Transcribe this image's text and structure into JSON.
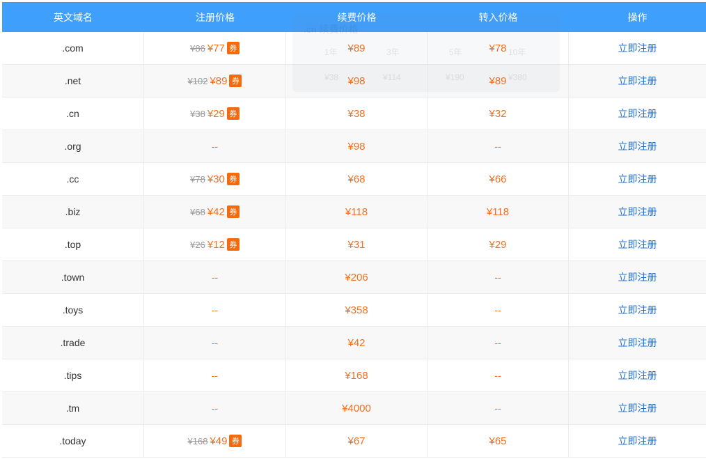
{
  "header": {
    "col_domain": "英文域名",
    "col_register": "注册价格",
    "col_renew": "续费价格",
    "col_transfer": "转入价格",
    "col_action": "操作"
  },
  "ghost_popup": {
    "title": ".cn 续费价格",
    "years": [
      "1年",
      "3年",
      "5年",
      "10年"
    ],
    "prices": [
      "¥38",
      "¥114",
      "¥190",
      "¥380"
    ]
  },
  "coupon_label": "券",
  "action_label": "立即注册",
  "rows": [
    {
      "domain": ".com",
      "orig": "¥86",
      "reg": "¥77",
      "renew": "¥89",
      "transfer": "¥78"
    },
    {
      "domain": ".net",
      "orig": "¥102",
      "reg": "¥89",
      "renew": "¥98",
      "transfer": "¥89"
    },
    {
      "domain": ".cn",
      "orig": "¥38",
      "reg": "¥29",
      "renew": "¥38",
      "transfer": "¥32"
    },
    {
      "domain": ".org",
      "orig": "",
      "reg": "--",
      "renew": "¥98",
      "transfer": "--"
    },
    {
      "domain": ".cc",
      "orig": "¥78",
      "reg": "¥30",
      "renew": "¥68",
      "transfer": "¥66"
    },
    {
      "domain": ".biz",
      "orig": "¥68",
      "reg": "¥42",
      "renew": "¥118",
      "transfer": "¥118"
    },
    {
      "domain": ".top",
      "orig": "¥26",
      "reg": "¥12",
      "renew": "¥31",
      "transfer": "¥29"
    },
    {
      "domain": ".town",
      "orig": "",
      "reg": "--",
      "renew": "¥206",
      "transfer": "--"
    },
    {
      "domain": ".toys",
      "orig": "",
      "reg": "--",
      "renew": "¥358",
      "transfer": "--"
    },
    {
      "domain": ".trade",
      "orig": "",
      "reg": "--",
      "renew": "¥42",
      "transfer": "--"
    },
    {
      "domain": ".tips",
      "orig": "",
      "reg": "--",
      "renew": "¥168",
      "transfer": "--"
    },
    {
      "domain": ".tm",
      "orig": "",
      "reg": "--",
      "renew": "¥4000",
      "transfer": "--"
    },
    {
      "domain": ".today",
      "orig": "¥168",
      "reg": "¥49",
      "renew": "¥67",
      "transfer": "¥65"
    }
  ]
}
